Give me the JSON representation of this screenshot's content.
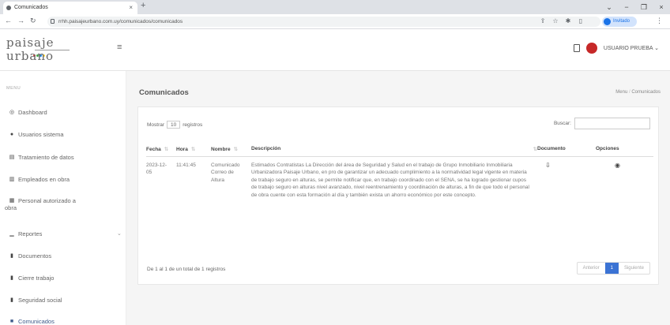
{
  "browser": {
    "tab_title": "Comunicados",
    "tab_close": "×",
    "new_tab": "+",
    "url": "rrhh.paisajeurbano.com.uy/comunicados/comunicados",
    "window_controls": [
      "⌄",
      "−",
      "❐",
      "×"
    ],
    "profile_label": "Invitado"
  },
  "header": {
    "logo_top": "paisaje",
    "logo_bottom": "urbano",
    "user_name": "USUARIO PRUEBA",
    "user_caret": "⌄",
    "menu_toggle": "≡"
  },
  "sidebar": {
    "menu_title": "MENU",
    "items": [
      {
        "label": "Dashboard",
        "icon": "◎"
      },
      {
        "label": "Usuarios sistema",
        "icon": "●"
      },
      {
        "label": "Tratamiento de datos",
        "icon": "▤"
      },
      {
        "label": "Empleados en obra",
        "icon": "▥"
      },
      {
        "label": "Personal autorizado a",
        "label2": "obra",
        "icon": "▦"
      },
      {
        "label": "Reportes",
        "icon": "▁",
        "chevron": "⌄"
      },
      {
        "label": "Documentos",
        "icon": "▮"
      },
      {
        "label": "Cierre trabajo",
        "icon": "▮"
      },
      {
        "label": "Seguridad social",
        "icon": "▮"
      },
      {
        "label": "Comunicados",
        "icon": "■"
      }
    ]
  },
  "page": {
    "title": "Comunicados",
    "breadcrumb": [
      "Menu",
      "Comunicados"
    ],
    "breadcrumb_sep": "/"
  },
  "table": {
    "show_label_pre": "Mostrar",
    "show_value": "10",
    "show_label_post": "registros",
    "search_label": "Buscar:",
    "columns": [
      "Fecha",
      "Hora",
      "Nombre",
      "Descripción",
      "Documento",
      "Opciones"
    ],
    "sort_icons": [
      "⇅",
      "⇅",
      "⇅",
      "⇅",
      "⇅"
    ],
    "rows": [
      {
        "fecha": "2023-12-05",
        "hora": "11:41:45",
        "nombre": "Comunicado Correo de Altura",
        "descripcion": "Estimados Contratistas La Dirección del área de Seguridad y Salud en el trabajo de Grupo Inmobiliario Inmobiliaria Urbanizadora Paisaje Urbano, en pro de garantizar un adecuado cumplimiento a la normatividad legal vigente en materia de trabajo seguro en alturas, se permite notificar que, en trabajo coordinado con el SENA, se ha logrado gestionar cupos de trabajo seguro en alturas nivel avanzado, nivel reentrenamiento y coordinación de alturas, a fin de que todo el personal de obra cuente con esta formación al día y también exista un ahorro económico por este concepto.",
        "doc_icon": "⇩",
        "option_icon": "◉"
      }
    ],
    "info": "De 1 al 1 de un total de 1 registros",
    "pager_prev": "Anterior",
    "pager_page": "1",
    "pager_next": "Siguiente"
  },
  "colors": {
    "accent": "#3b73d4",
    "sidebar_active": "#3d5a8a",
    "logo_dots": [
      "#e53935",
      "#43a047",
      "#1e88e5",
      "#fdd835"
    ]
  }
}
